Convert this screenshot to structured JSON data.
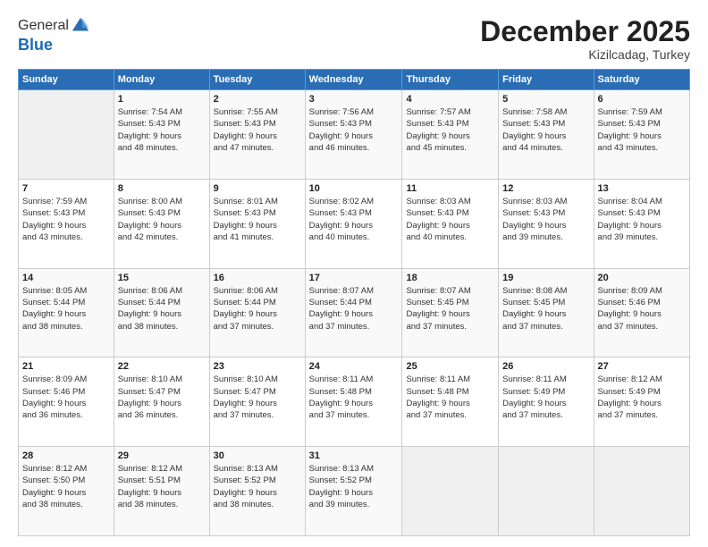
{
  "header": {
    "logo_general": "General",
    "logo_blue": "Blue",
    "month_title": "December 2025",
    "location": "Kizilcadag, Turkey"
  },
  "days_of_week": [
    "Sunday",
    "Monday",
    "Tuesday",
    "Wednesday",
    "Thursday",
    "Friday",
    "Saturday"
  ],
  "weeks": [
    [
      {
        "day": "",
        "info": ""
      },
      {
        "day": "1",
        "info": "Sunrise: 7:54 AM\nSunset: 5:43 PM\nDaylight: 9 hours\nand 48 minutes."
      },
      {
        "day": "2",
        "info": "Sunrise: 7:55 AM\nSunset: 5:43 PM\nDaylight: 9 hours\nand 47 minutes."
      },
      {
        "day": "3",
        "info": "Sunrise: 7:56 AM\nSunset: 5:43 PM\nDaylight: 9 hours\nand 46 minutes."
      },
      {
        "day": "4",
        "info": "Sunrise: 7:57 AM\nSunset: 5:43 PM\nDaylight: 9 hours\nand 45 minutes."
      },
      {
        "day": "5",
        "info": "Sunrise: 7:58 AM\nSunset: 5:43 PM\nDaylight: 9 hours\nand 44 minutes."
      },
      {
        "day": "6",
        "info": "Sunrise: 7:59 AM\nSunset: 5:43 PM\nDaylight: 9 hours\nand 43 minutes."
      }
    ],
    [
      {
        "day": "7",
        "info": "Sunrise: 7:59 AM\nSunset: 5:43 PM\nDaylight: 9 hours\nand 43 minutes."
      },
      {
        "day": "8",
        "info": "Sunrise: 8:00 AM\nSunset: 5:43 PM\nDaylight: 9 hours\nand 42 minutes."
      },
      {
        "day": "9",
        "info": "Sunrise: 8:01 AM\nSunset: 5:43 PM\nDaylight: 9 hours\nand 41 minutes."
      },
      {
        "day": "10",
        "info": "Sunrise: 8:02 AM\nSunset: 5:43 PM\nDaylight: 9 hours\nand 40 minutes."
      },
      {
        "day": "11",
        "info": "Sunrise: 8:03 AM\nSunset: 5:43 PM\nDaylight: 9 hours\nand 40 minutes."
      },
      {
        "day": "12",
        "info": "Sunrise: 8:03 AM\nSunset: 5:43 PM\nDaylight: 9 hours\nand 39 minutes."
      },
      {
        "day": "13",
        "info": "Sunrise: 8:04 AM\nSunset: 5:43 PM\nDaylight: 9 hours\nand 39 minutes."
      }
    ],
    [
      {
        "day": "14",
        "info": "Sunrise: 8:05 AM\nSunset: 5:44 PM\nDaylight: 9 hours\nand 38 minutes."
      },
      {
        "day": "15",
        "info": "Sunrise: 8:06 AM\nSunset: 5:44 PM\nDaylight: 9 hours\nand 38 minutes."
      },
      {
        "day": "16",
        "info": "Sunrise: 8:06 AM\nSunset: 5:44 PM\nDaylight: 9 hours\nand 37 minutes."
      },
      {
        "day": "17",
        "info": "Sunrise: 8:07 AM\nSunset: 5:44 PM\nDaylight: 9 hours\nand 37 minutes."
      },
      {
        "day": "18",
        "info": "Sunrise: 8:07 AM\nSunset: 5:45 PM\nDaylight: 9 hours\nand 37 minutes."
      },
      {
        "day": "19",
        "info": "Sunrise: 8:08 AM\nSunset: 5:45 PM\nDaylight: 9 hours\nand 37 minutes."
      },
      {
        "day": "20",
        "info": "Sunrise: 8:09 AM\nSunset: 5:46 PM\nDaylight: 9 hours\nand 37 minutes."
      }
    ],
    [
      {
        "day": "21",
        "info": "Sunrise: 8:09 AM\nSunset: 5:46 PM\nDaylight: 9 hours\nand 36 minutes."
      },
      {
        "day": "22",
        "info": "Sunrise: 8:10 AM\nSunset: 5:47 PM\nDaylight: 9 hours\nand 36 minutes."
      },
      {
        "day": "23",
        "info": "Sunrise: 8:10 AM\nSunset: 5:47 PM\nDaylight: 9 hours\nand 37 minutes."
      },
      {
        "day": "24",
        "info": "Sunrise: 8:11 AM\nSunset: 5:48 PM\nDaylight: 9 hours\nand 37 minutes."
      },
      {
        "day": "25",
        "info": "Sunrise: 8:11 AM\nSunset: 5:48 PM\nDaylight: 9 hours\nand 37 minutes."
      },
      {
        "day": "26",
        "info": "Sunrise: 8:11 AM\nSunset: 5:49 PM\nDaylight: 9 hours\nand 37 minutes."
      },
      {
        "day": "27",
        "info": "Sunrise: 8:12 AM\nSunset: 5:49 PM\nDaylight: 9 hours\nand 37 minutes."
      }
    ],
    [
      {
        "day": "28",
        "info": "Sunrise: 8:12 AM\nSunset: 5:50 PM\nDaylight: 9 hours\nand 38 minutes."
      },
      {
        "day": "29",
        "info": "Sunrise: 8:12 AM\nSunset: 5:51 PM\nDaylight: 9 hours\nand 38 minutes."
      },
      {
        "day": "30",
        "info": "Sunrise: 8:13 AM\nSunset: 5:52 PM\nDaylight: 9 hours\nand 38 minutes."
      },
      {
        "day": "31",
        "info": "Sunrise: 8:13 AM\nSunset: 5:52 PM\nDaylight: 9 hours\nand 39 minutes."
      },
      {
        "day": "",
        "info": ""
      },
      {
        "day": "",
        "info": ""
      },
      {
        "day": "",
        "info": ""
      }
    ]
  ]
}
